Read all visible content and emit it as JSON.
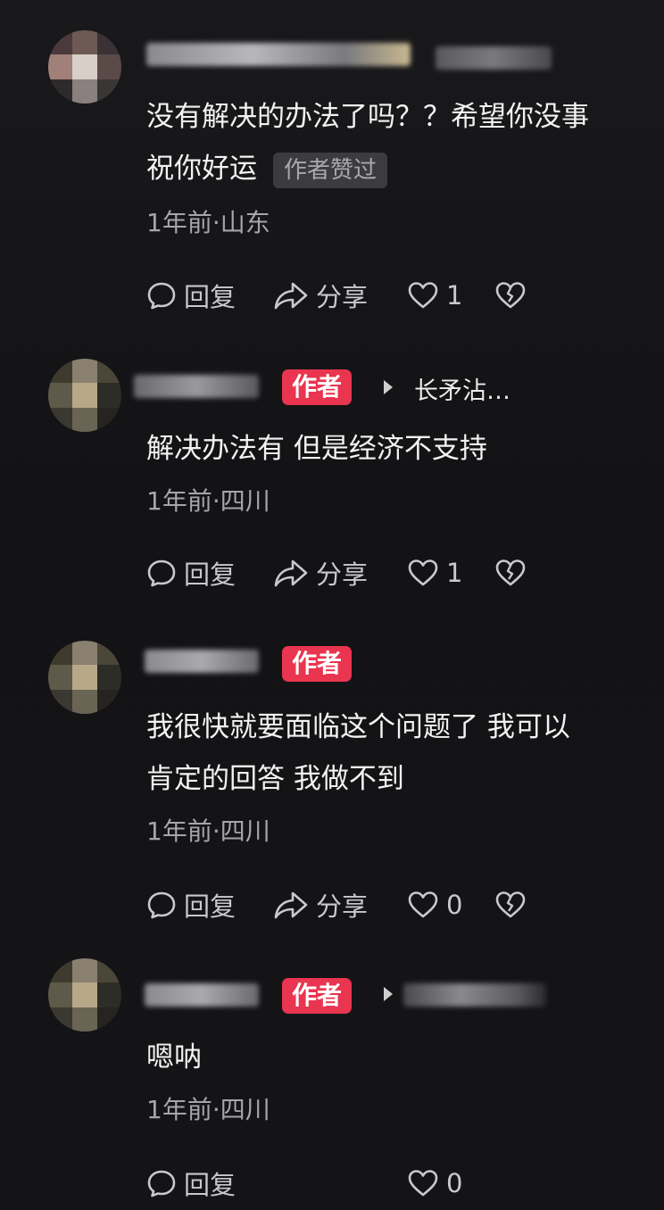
{
  "comments": [
    {
      "text_lines": [
        "没有解决的办法了吗？？希望你没事",
        "祝你好运"
      ],
      "tag": "作者赞过",
      "meta": "1年前·山东",
      "actions": {
        "reply": "回复",
        "share": "分享",
        "likes": "1"
      }
    },
    {
      "badge": "作者",
      "reply_to": "长矛沾…",
      "text_lines": [
        "解决办法有 但是经济不支持"
      ],
      "meta": "1年前·四川",
      "actions": {
        "reply": "回复",
        "share": "分享",
        "likes": "1"
      }
    },
    {
      "badge": "作者",
      "text_lines": [
        "我很快就要面临这个问题了 我可以",
        "肯定的回答 我做不到"
      ],
      "meta": "1年前·四川",
      "actions": {
        "reply": "回复",
        "share": "分享",
        "likes": "0"
      }
    },
    {
      "badge": "作者",
      "text_lines": [
        "嗯呐"
      ],
      "meta": "1年前·四川",
      "actions": {
        "reply": "回复",
        "likes": "0"
      }
    }
  ],
  "colors": {
    "background": "#151517",
    "author_badge": "#e9354f",
    "liked_tag_bg": "#3c3c40",
    "meta_text": "#a6a6aa"
  },
  "icons": [
    "comment-bubble-icon",
    "share-arrow-icon",
    "heart-outline-icon",
    "broken-heart-icon",
    "caret-right-icon"
  ]
}
